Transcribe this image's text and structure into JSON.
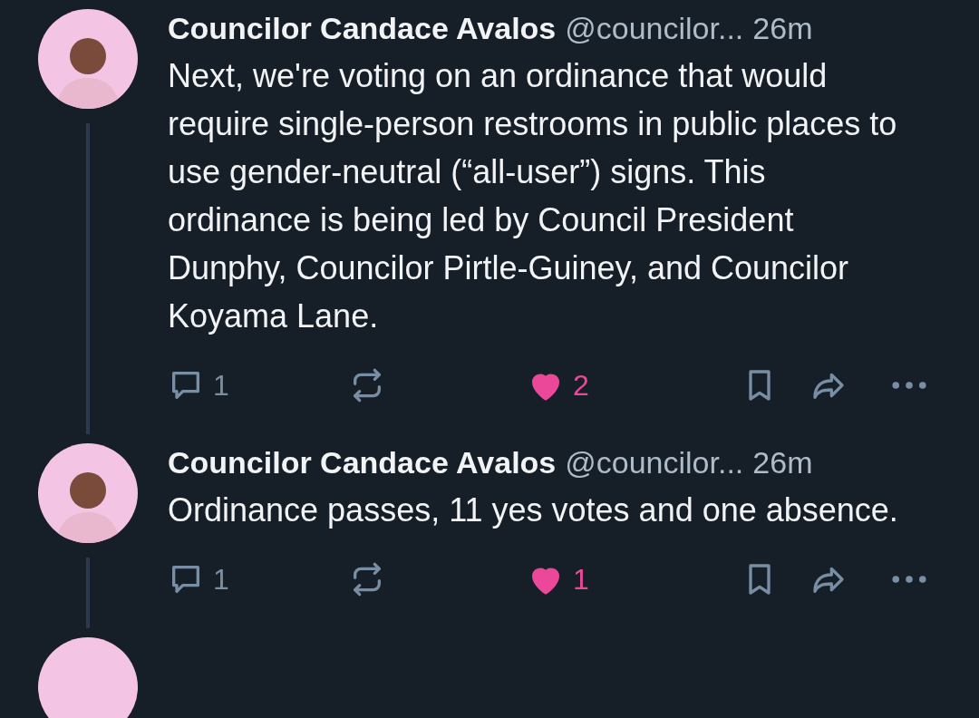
{
  "posts": [
    {
      "author": "Councilor Candace Avalos",
      "handle": "@councilor...",
      "time": "26m",
      "text": "Next, we're voting on an ordinance that would require single-person restrooms in public places to use gender-neutral (“all-user”) signs. This ordinance is being led by Council President Dunphy, Councilor Pirtle-Guiney, and Councilor Koyama Lane.",
      "replies": "1",
      "likes": "2",
      "liked": true,
      "thread_continues": true
    },
    {
      "author": "Councilor Candace Avalos",
      "handle": "@councilor...",
      "time": "26m",
      "text": "Ordinance passes, 11 yes votes and one absence.",
      "replies": "1",
      "likes": "1",
      "liked": true,
      "thread_continues": true
    }
  ],
  "next_post_partial": true
}
